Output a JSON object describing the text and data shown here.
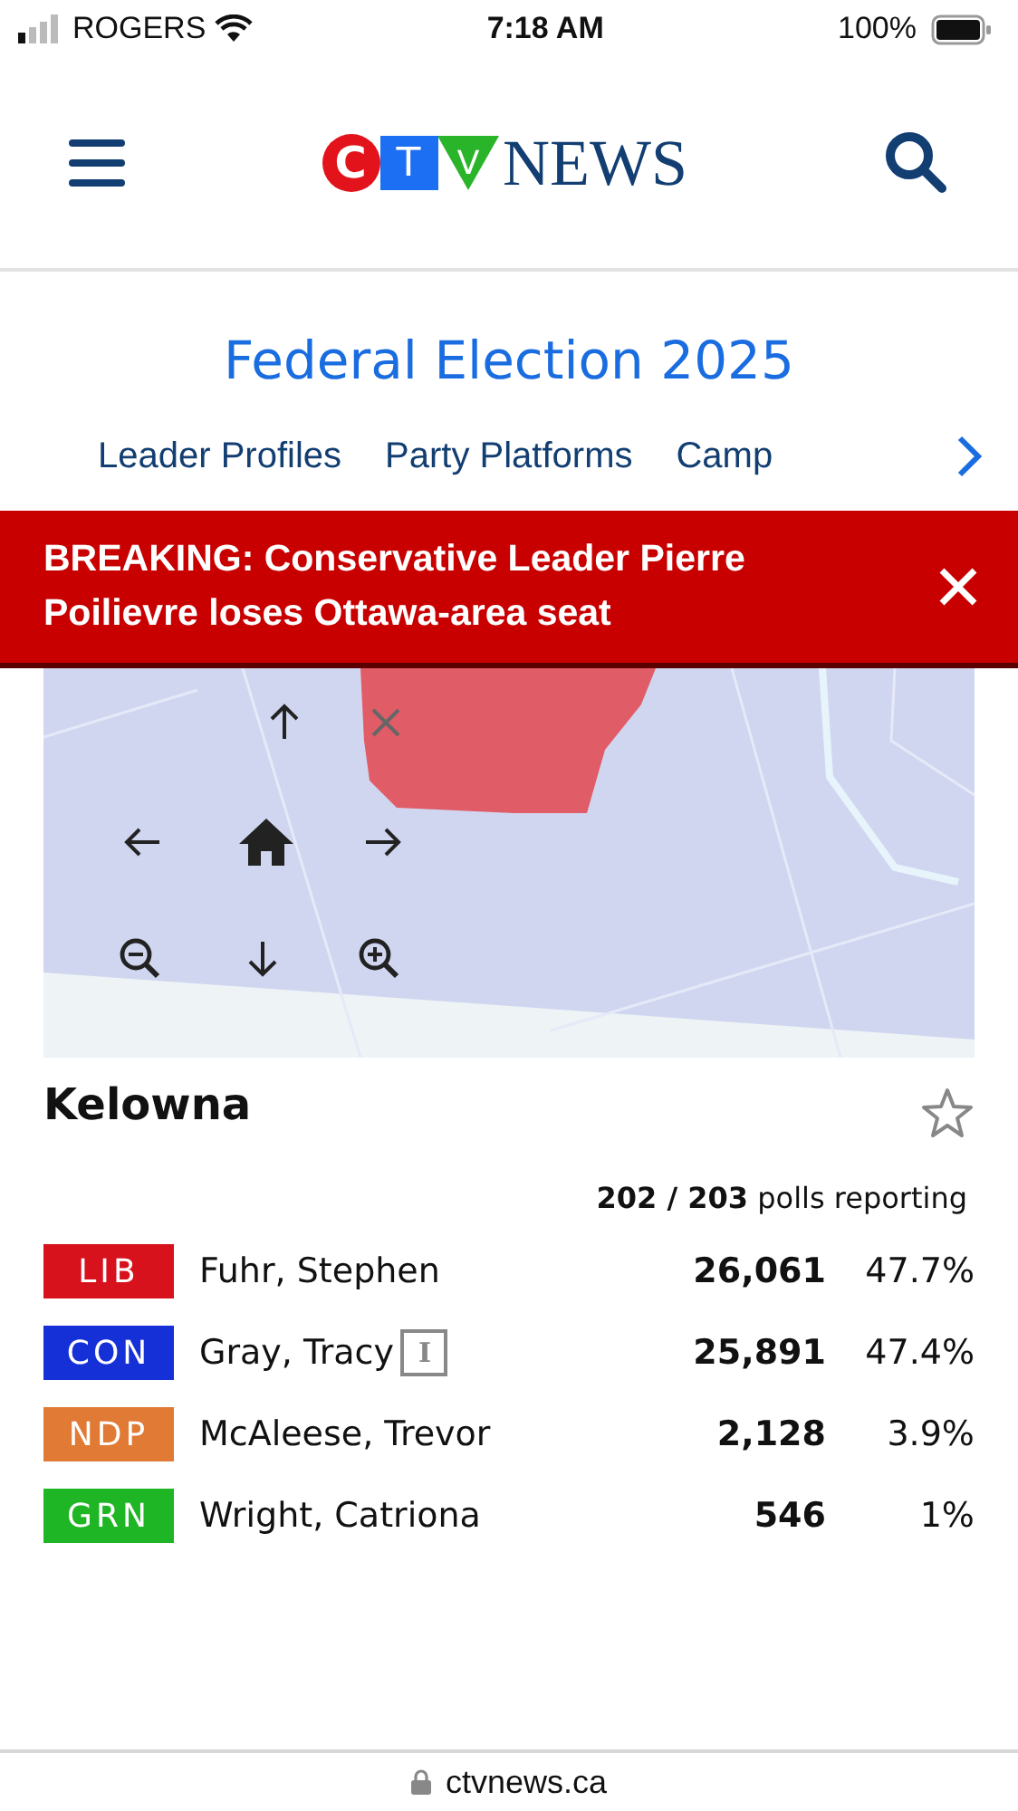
{
  "status_bar": {
    "carrier": "ROGERS",
    "time": "7:18 AM",
    "battery": "100%"
  },
  "logo": {
    "letters": [
      "C",
      "T",
      "V"
    ],
    "word": "NEWS"
  },
  "section": {
    "title": "Federal Election 2025",
    "nav": [
      {
        "label": "Leader Profiles"
      },
      {
        "label": "Party Platforms"
      },
      {
        "label": "Camp"
      }
    ]
  },
  "breaking": {
    "text": "BREAKING: Conservative Leader Pierre Poilievre loses Ottawa-area seat"
  },
  "riding": {
    "name": "Kelowna",
    "favorite": false,
    "polls_count": "202 / 203",
    "polls_label": "polls reporting",
    "candidates": [
      {
        "party": "LIB",
        "color": "#d7121c",
        "name": "Fuhr, Stephen",
        "votes": "26,061",
        "share": "47.7%"
      },
      {
        "party": "CON",
        "color": "#1530d6",
        "name": "Gray, Tracy",
        "incumbent_mark": "I",
        "votes": "25,891",
        "share": "47.4%"
      },
      {
        "party": "NDP",
        "color": "#e07a35",
        "name": "McAleese, Trevor",
        "votes": "2,128",
        "share": "3.9%"
      },
      {
        "party": "GRN",
        "color": "#1fb626",
        "name": "Wright, Catriona",
        "votes": "546",
        "share": "1%"
      }
    ]
  },
  "browser": {
    "url": "ctvnews.ca"
  }
}
